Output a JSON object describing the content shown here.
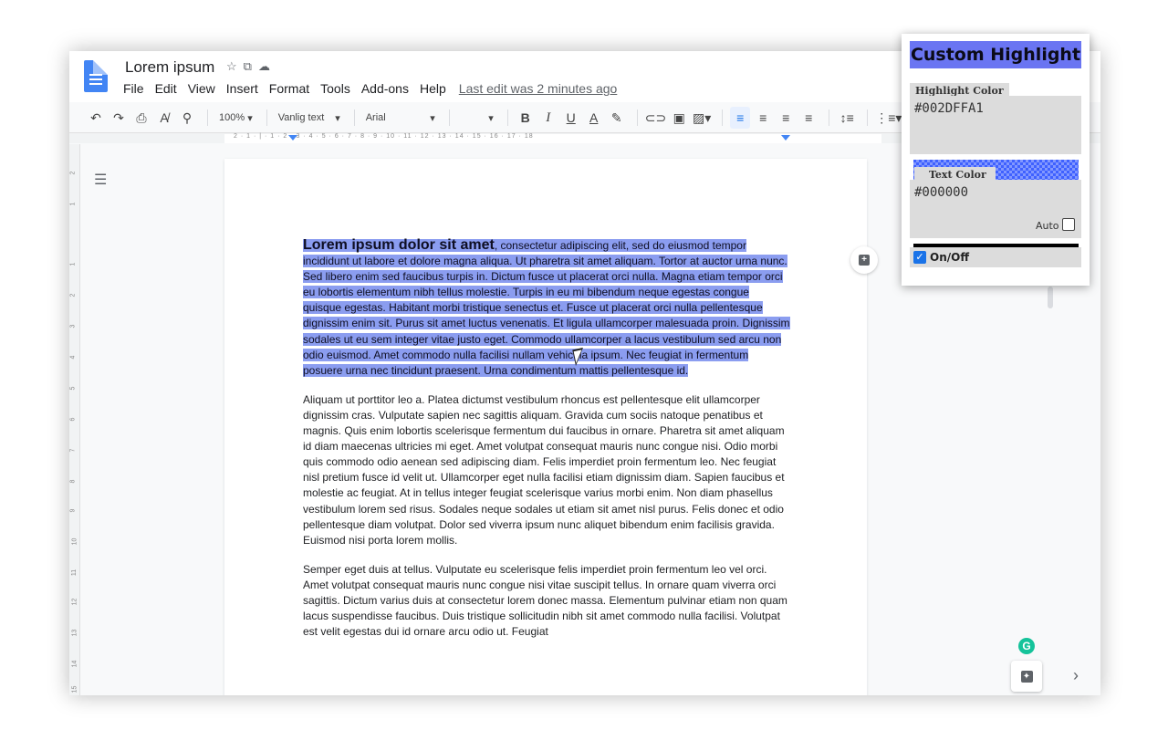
{
  "doc": {
    "title": "Lorem ipsum",
    "menu": [
      "File",
      "Edit",
      "View",
      "Insert",
      "Format",
      "Tools",
      "Add-ons",
      "Help"
    ],
    "last_edit": "Last edit was 2 minutes ago"
  },
  "toolbar": {
    "zoom": "100%",
    "style": "Vanlig text",
    "font": "Arial",
    "bold": "B",
    "italic": "I",
    "underline": "U",
    "text_color": "A"
  },
  "ruler": {
    "h_numbers": "2 · 1 · | · 1 · 2 · 3 · 4 · 5 · 6 · 7 · 8 · 9 · 10 · 11 · 12 · 13 · 14 · 15 · 16 · 17 · 18",
    "v_numbers": [
      "2",
      "1",
      "1",
      "2",
      "3",
      "4",
      "5",
      "6",
      "7",
      "8",
      "9",
      "10",
      "11",
      "12",
      "13",
      "14",
      "15"
    ]
  },
  "content": {
    "p1_bold": "Lorem ipsum dolor sit amet",
    "p1_rest": ", consectetur adipiscing elit, sed do eiusmod tempor incididunt ut labore et dolore magna aliqua. Ut pharetra sit amet aliquam. Tortor at auctor urna nunc. Sed libero enim sed faucibus turpis in. Dictum fusce ut placerat orci nulla. Magna etiam tempor orci eu lobortis elementum nibh tellus molestie. Turpis in eu mi bibendum neque egestas congue quisque egestas. Habitant morbi tristique senectus et. Fusce ut placerat orci nulla pellentesque dignissim enim sit. Purus sit amet luctus venenatis. Et ligula ullamcorper malesuada proin. Dignissim sodales ut eu sem integer vitae justo eget. Commodo ullamcorper a lacus vestibulum sed arcu non odio euismod. Amet commodo nulla facilisi nullam vehicula ipsum. Nec feugiat in fermentum posuere urna nec tincidunt praesent. Urna condimentum mattis pellentesque id.",
    "p2": "Aliquam ut porttitor leo a. Platea dictumst vestibulum rhoncus est pellentesque elit ullamcorper dignissim cras. Vulputate sapien nec sagittis aliquam. Gravida cum sociis natoque penatibus et magnis. Quis enim lobortis scelerisque fermentum dui faucibus in ornare. Pharetra sit amet aliquam id diam maecenas ultricies mi eget. Amet volutpat consequat mauris nunc congue nisi. Odio morbi quis commodo odio aenean sed adipiscing diam. Felis imperdiet proin fermentum leo. Nec feugiat nisl pretium fusce id velit ut. Ullamcorper eget nulla facilisi etiam dignissim diam. Sapien faucibus et molestie ac feugiat. At in tellus integer feugiat scelerisque varius morbi enim. Non diam phasellus vestibulum lorem sed risus. Sodales neque sodales ut etiam sit amet nisl purus. Felis donec et odio pellentesque diam volutpat. Dolor sed viverra ipsum nunc aliquet bibendum enim facilisis gravida. Euismod nisi porta lorem mollis.",
    "p3": "Semper eget duis at tellus. Vulputate eu scelerisque felis imperdiet proin fermentum leo vel orci. Amet volutpat consequat mauris nunc congue nisi vitae suscipit tellus. In ornare quam viverra orci sagittis. Dictum varius duis at consectetur lorem donec massa. Elementum pulvinar etiam non quam lacus suspendisse faucibus. Duis tristique sollicitudin nibh sit amet commodo nulla facilisi. Volutpat est velit egestas dui id ornare arcu odio ut. Feugiat"
  },
  "extension": {
    "title": "Custom Highlight",
    "highlight_label": "Highlight Color",
    "highlight_value": "#002DFFA1",
    "text_label": "Text Color",
    "text_value": "#000000",
    "auto_label": "Auto",
    "onoff_label": "On/Off",
    "colors": {
      "highlight": "#002DFFA1",
      "text": "#000000",
      "selection": "#8b9df0"
    }
  },
  "icons": [
    "undo-icon",
    "redo-icon",
    "print-icon",
    "spellcheck-icon",
    "paint-format-icon",
    "link-icon",
    "comment-icon",
    "image-icon",
    "align-left-icon",
    "align-center-icon",
    "align-right-icon",
    "justify-icon",
    "line-spacing-icon",
    "numbered-list-icon",
    "bulleted-list-icon",
    "star-icon",
    "folder-icon",
    "cloud-icon",
    "outline-icon",
    "grammarly-icon",
    "explore-icon",
    "chevron-right-icon"
  ]
}
